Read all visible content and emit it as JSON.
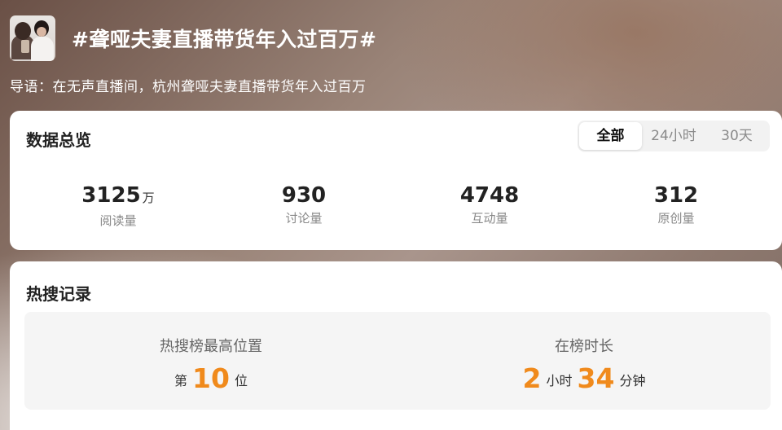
{
  "topic": {
    "title": "#聋哑夫妻直播带货年入过百万#",
    "lead": "导语：在无声直播间，杭州聋哑夫妻直播带货年入过百万"
  },
  "overview": {
    "title": "数据总览",
    "tabs": [
      "全部",
      "24小时",
      "30天"
    ],
    "active_tab": "全部",
    "stats": [
      {
        "value": "3125",
        "unit": "万",
        "label": "阅读量"
      },
      {
        "value": "930",
        "unit": "",
        "label": "讨论量"
      },
      {
        "value": "4748",
        "unit": "",
        "label": "互动量"
      },
      {
        "value": "312",
        "unit": "",
        "label": "原创量"
      }
    ]
  },
  "hot_search": {
    "title": "热搜记录",
    "highest": {
      "label": "热搜榜最高位置",
      "prefix": "第",
      "value": "10",
      "suffix": "位"
    },
    "duration": {
      "label": "在榜时长",
      "hours": "2",
      "hours_unit": "小时",
      "minutes": "34",
      "minutes_unit": "分钟"
    }
  },
  "colors": {
    "accent": "#f08a1c",
    "card": "#ffffff",
    "panel": "#f5f5f5"
  }
}
